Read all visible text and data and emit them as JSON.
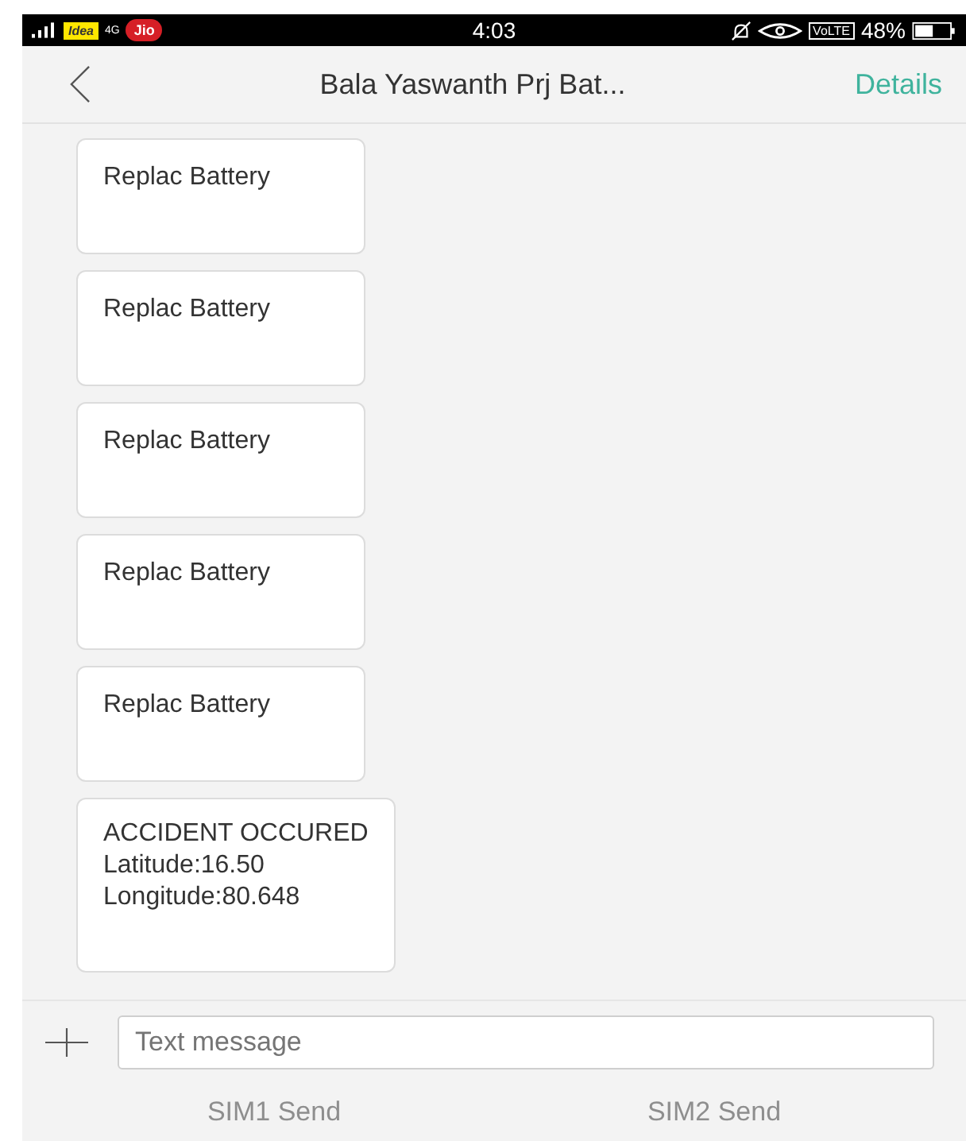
{
  "status_bar": {
    "carrier_1": "Idea",
    "network_1": "4G",
    "carrier_2": "Jio",
    "time": "4:03",
    "volte": "VoLTE",
    "battery": "48%"
  },
  "header": {
    "title": "Bala Yaswanth Prj Bat...",
    "action": "Details"
  },
  "messages": [
    {
      "lines": [
        "Replac Battery"
      ]
    },
    {
      "lines": [
        "Replac Battery"
      ]
    },
    {
      "lines": [
        "Replac Battery"
      ]
    },
    {
      "lines": [
        "Replac Battery"
      ]
    },
    {
      "lines": [
        "Replac Battery"
      ]
    },
    {
      "lines": [
        "ACCIDENT OCCURED",
        "Latitude:16.50",
        "Longitude:80.648"
      ]
    }
  ],
  "composer": {
    "placeholder": "Text message"
  },
  "send_buttons": [
    {
      "label": "SIM1 Send",
      "disabled": true
    },
    {
      "label": "SIM2 Send",
      "disabled": true
    }
  ]
}
